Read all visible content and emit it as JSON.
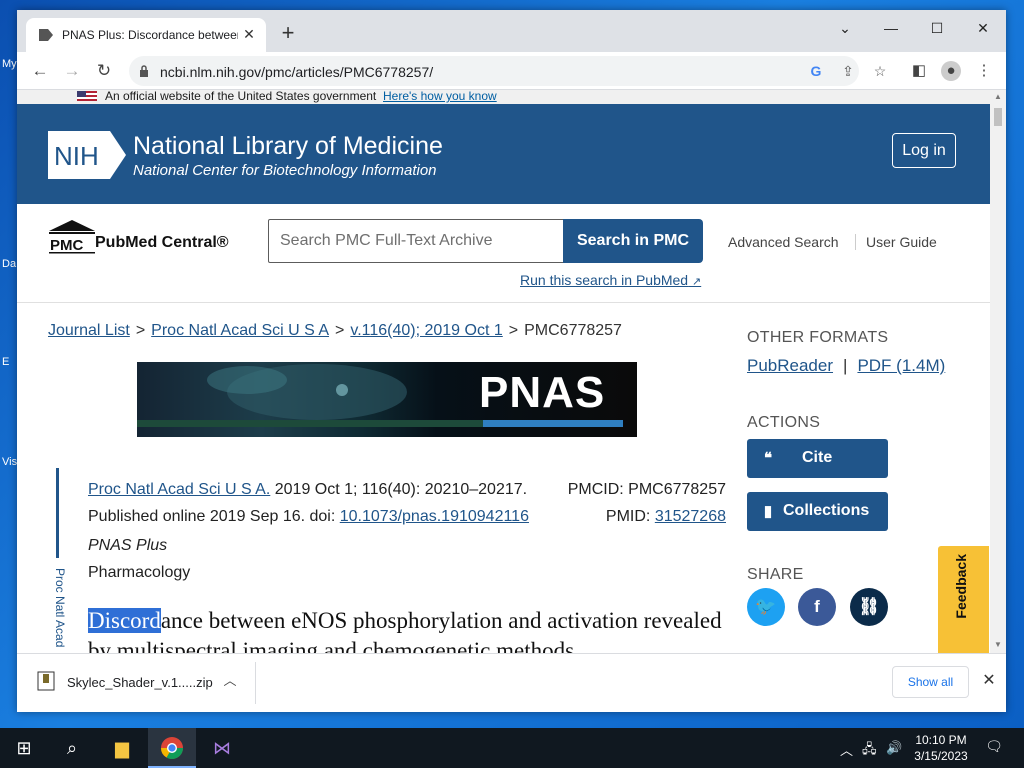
{
  "desktop": {
    "labels": [
      "My",
      "Da",
      "E",
      "Vis"
    ]
  },
  "browser": {
    "tab_title": "PNAS Plus: Discordance between eNOS phosphorylation",
    "url": "ncbi.nlm.nih.gov/pmc/articles/PMC6778257/"
  },
  "gov_banner": {
    "text": "An official website of the United States government",
    "link": "Here's how you know"
  },
  "header": {
    "logo": "NIH",
    "title": "National Library of Medicine",
    "subtitle": "National Center for Biotechnology Information",
    "login": "Log in"
  },
  "pmc": {
    "logo_text": "PMC",
    "name": "PubMed Central®",
    "search_placeholder": "Search PMC Full-Text Archive",
    "search_button": "Search in PMC",
    "advanced": "Advanced Search",
    "guide": "User Guide",
    "run_pubmed": "Run this search in PubMed"
  },
  "breadcrumb": {
    "journal_list": "Journal List",
    "journal": "Proc Natl Acad Sci U S A",
    "volume": "v.116(40); 2019 Oct 1",
    "current": "PMC6778257",
    "separator": ">"
  },
  "banner": {
    "word": "PNAS"
  },
  "citation": {
    "journal_link": "Proc Natl Acad Sci U S A.",
    "details": " 2019 Oct 1; 116(40): 20210–20217.",
    "published": "Published online 2019 Sep 16. doi: ",
    "doi": "10.1073/pnas.1910942116",
    "pmcid": "PMCID: PMC6778257",
    "pmid_label": "PMID: ",
    "pmid": "31527268",
    "section": "PNAS Plus",
    "category": "Pharmacology",
    "vertical": "Proc Natl Acad"
  },
  "article": {
    "title_highlight": "Discord",
    "title_rest": "ance between eNOS phosphorylation and activation revealed by multispectral imaging and chemogenetic methods"
  },
  "sidebar": {
    "other_formats": "OTHER FORMATS",
    "pubreader": "PubReader",
    "pdf": "PDF (1.4M)",
    "actions": "ACTIONS",
    "cite": "Cite",
    "collections": "Collections",
    "share": "SHARE"
  },
  "feedback": "Feedback",
  "download": {
    "filename": "Skylec_Shader_v.1.....zip",
    "show_all": "Show all"
  },
  "clock": {
    "time": "10:10 PM",
    "date": "3/15/2023"
  },
  "colors": {
    "ncbi_blue": "#20558a",
    "feedback_yellow": "#f7c136",
    "twitter": "#1da1f2",
    "facebook": "#3b5998",
    "link_share": "#0b2b4a"
  }
}
